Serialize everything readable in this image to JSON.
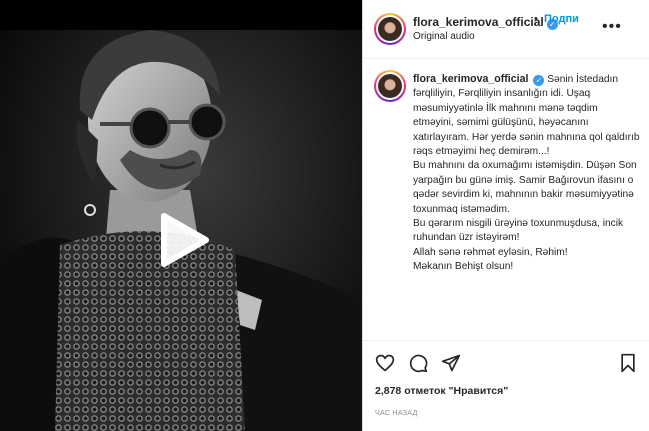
{
  "post": {
    "media": {
      "type": "video",
      "play_icon": "play-icon"
    },
    "header": {
      "username": "flora_kerimova_official",
      "verified_icon": "verified-badge-icon",
      "separator": "•",
      "follow_label": "Подпи",
      "audio": "Original audio",
      "more_icon": "more-options-icon"
    },
    "caption": {
      "username": "flora_kerimova_official",
      "text": "Sənin İstedadın fərqliliyin, Fərqliliyin insanlığın idi. Uşaq məsumiyyətinlə İlk mahnını mənə təqdim etməyini, səmimi gülüşünü, həyəcanını xatırlayıram. Hər yerdə sənin mahnına qol qaldırıb rəqs etməyimi heç demirəm...!\nBu mahnını da oxumağımı istəmişdin. Düşən Son yarpağın bu günə imiş. Samir Bağırovun ifasını o qədər sevirdim ki, mahnının bakir məsumiyyətinə toxunmaq istəmədim.\nBu qərarım nisgili ürəyinə toxunmuşdusa, incik ruhundan üzr istəyirəm!\nAllah sənə rəhmət eyləsin, Rəhim!\nMəkanın Behişt olsun!"
    },
    "actions": {
      "like_icon": "heart-icon",
      "comment_icon": "comment-icon",
      "share_icon": "share-icon",
      "save_icon": "bookmark-icon"
    },
    "likes_text": "2,878 отметок \"Нравится\"",
    "time_text": "ЧАС НАЗАД"
  }
}
